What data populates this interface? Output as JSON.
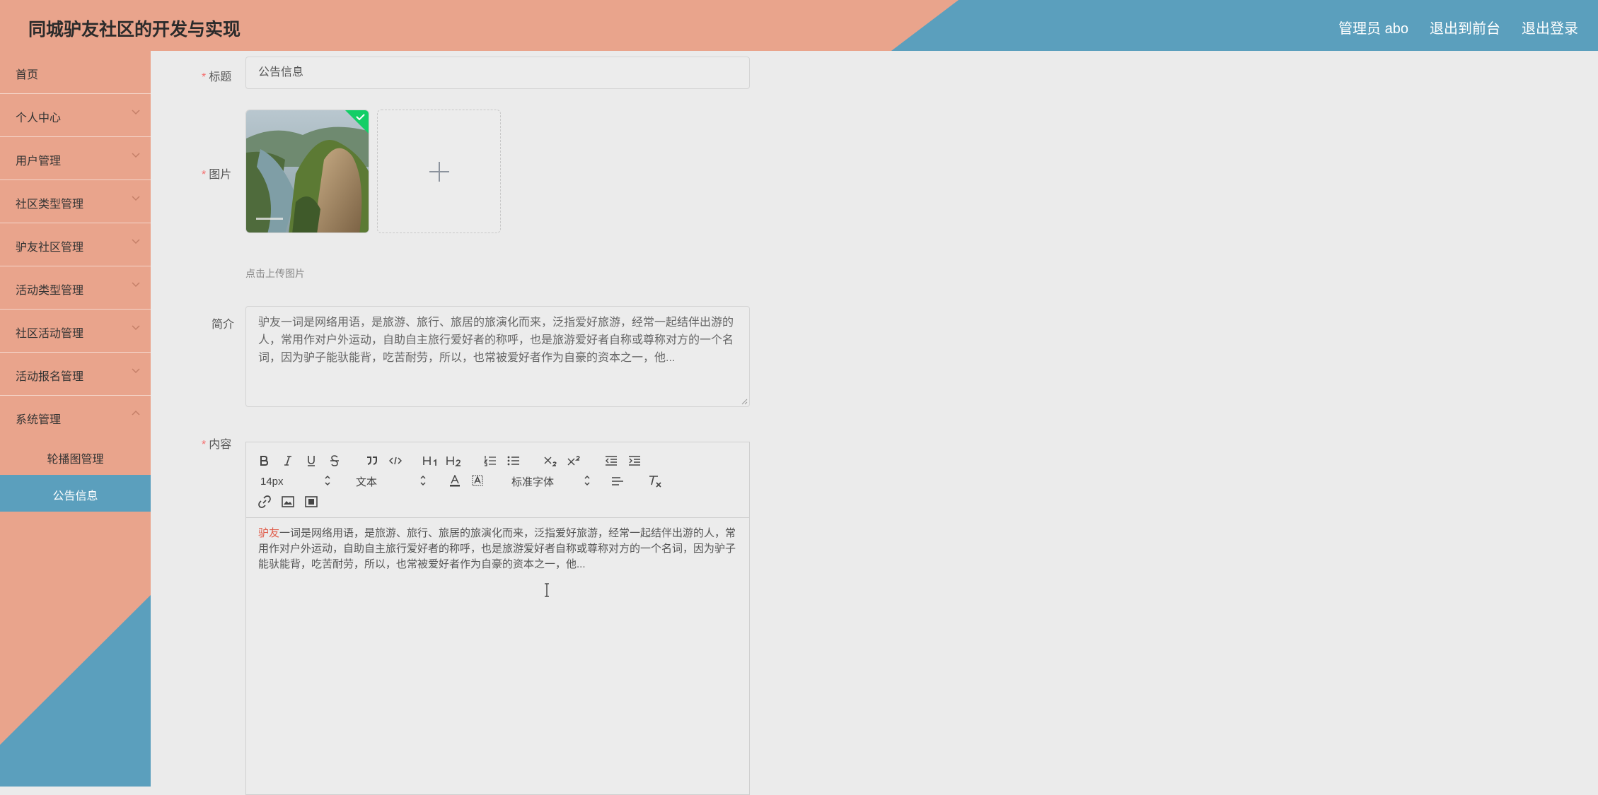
{
  "header": {
    "title": "同城驴友社区的开发与实现",
    "nav": {
      "admin": "管理员 abo",
      "front": "退出到前台",
      "logout": "退出登录"
    }
  },
  "sidebar": {
    "items": [
      {
        "label": "首页"
      },
      {
        "label": "个人中心"
      },
      {
        "label": "用户管理"
      },
      {
        "label": "社区类型管理"
      },
      {
        "label": "驴友社区管理"
      },
      {
        "label": "活动类型管理"
      },
      {
        "label": "社区活动管理"
      },
      {
        "label": "活动报名管理"
      },
      {
        "label": "系统管理"
      }
    ],
    "subitems": [
      {
        "label": "轮播图管理"
      },
      {
        "label": "公告信息",
        "active": true
      }
    ]
  },
  "form": {
    "title": {
      "label": "标题",
      "value": "公告信息"
    },
    "image": {
      "label": "图片",
      "upload_tip": "点击上传图片"
    },
    "intro": {
      "label": "简介",
      "value": "驴友一词是网络用语，是旅游、旅行、旅居的旅演化而来，泛指爱好旅游，经常一起结伴出游的人，常用作对户外运动，自助自主旅行爱好者的称呼，也是旅游爱好者自称或尊称对方的一个名词，因为驴子能驮能背，吃苦耐劳，所以，也常被爱好者作为自豪的资本之一，他..."
    },
    "content": {
      "label": "内容",
      "font_size": "14px",
      "block_type": "文本",
      "font_family": "标准字体",
      "text_highlight": "驴友",
      "text_rest": "一词是网络用语，是旅游、旅行、旅居的旅演化而来，泛指爱好旅游，经常一起结伴出游的人，常用作对户外运动，自助自主旅行爱好者的称呼，也是旅游爱好者自称或尊称对方的一个名词，因为驴子能驮能背，吃苦耐劳，所以，也常被爱好者作为自豪的资本之一，他..."
    }
  },
  "colors": {
    "salmon": "#e9a48c",
    "blue": "#5b9fbd",
    "required": "#f56c6c",
    "success": "#13ce66"
  }
}
